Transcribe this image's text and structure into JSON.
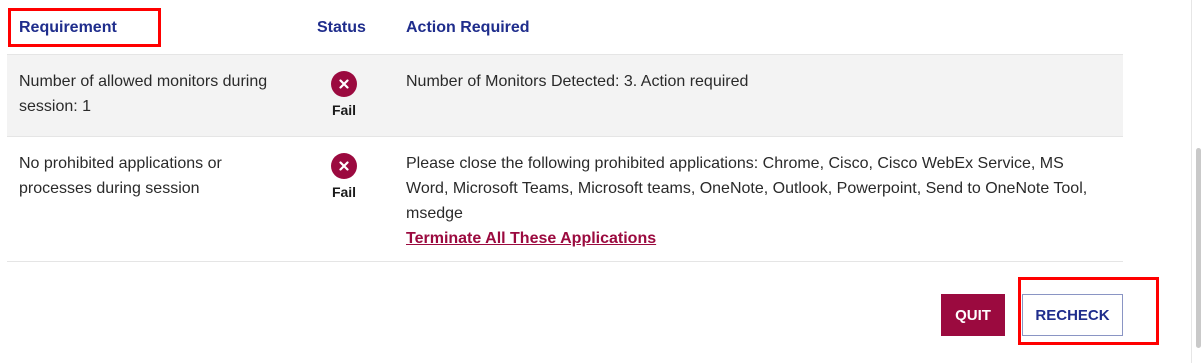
{
  "header": {
    "requirement": "Requirement",
    "status": "Status",
    "action_required": "Action Required"
  },
  "rows": [
    {
      "requirement": "Number of allowed monitors during session: 1",
      "status": "Fail",
      "status_icon": "fail-x-icon",
      "action": "Number of Monitors Detected: 3. Action required"
    },
    {
      "requirement": "No prohibited applications or processes during session",
      "status": "Fail",
      "status_icon": "fail-x-icon",
      "action": "Please close the following prohibited applications: Chrome, Cisco, Cisco WebEx Service, MS Word, Microsoft Teams, Microsoft teams, OneNote, Outlook, Powerpoint, Send to OneNote Tool, msedge",
      "action_link": "Terminate All These Applications"
    }
  ],
  "buttons": {
    "quit": "QUIT",
    "recheck": "RECHECK"
  },
  "colors": {
    "heading_navy": "#1f2d8c",
    "fail_maroon": "#9b0a3f",
    "row_shade": "#f3f3f3",
    "annotation_red": "#ff0000"
  }
}
